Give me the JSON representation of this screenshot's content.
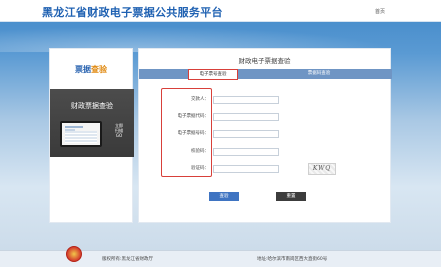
{
  "header": {
    "site_title": "黑龙江省财政电子票据公共服务平台",
    "home_link": "首页"
  },
  "left_panel": {
    "heading_part1": "票据",
    "heading_part2": "查验",
    "feature_label": "财政票据查验",
    "qr_text_line1": "立即",
    "qr_text_line2": "扫描",
    "qr_text_line3": "GO"
  },
  "main_panel": {
    "title": "财政电子票据查验",
    "tabs": [
      {
        "label": "电子票号查验",
        "active": true
      },
      {
        "label": "票据码查验",
        "active": false
      }
    ],
    "fields": [
      {
        "label": "交款人：",
        "value": ""
      },
      {
        "label": "电子票据代码：",
        "value": ""
      },
      {
        "label": "电子票据号码：",
        "value": ""
      },
      {
        "label": "校验码：",
        "value": ""
      },
      {
        "label": "验证码：",
        "value": ""
      }
    ],
    "captcha_text": "KWQ",
    "buttons": {
      "query": "查验",
      "reset": "重置"
    }
  },
  "footer": {
    "copyright": "版权所有:黑龙江省财政厅",
    "address": "地址:哈尔滨市南岗区西大直街60号"
  },
  "colors": {
    "brand_blue": "#1f61b2",
    "tab_bar": "#6f95c4",
    "highlight_red": "#d8403a",
    "query_button": "#3f74c2",
    "reset_button": "#3c3c3c"
  }
}
